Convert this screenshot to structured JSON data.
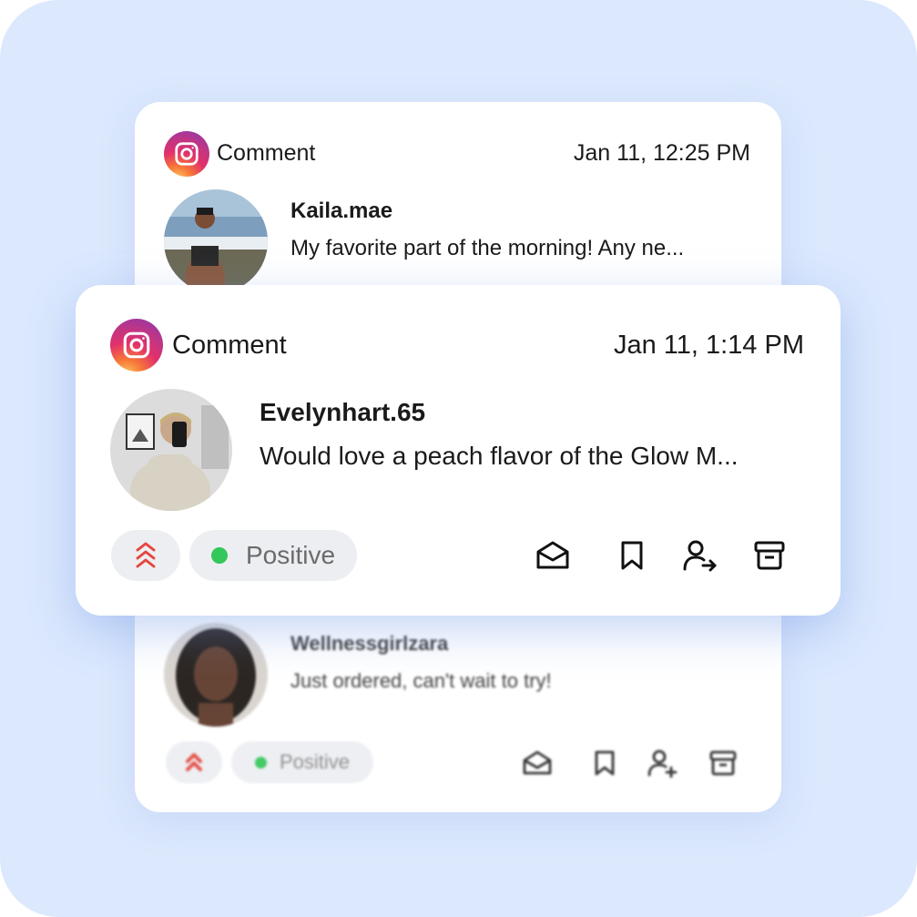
{
  "cards": {
    "top": {
      "type_label": "Comment",
      "timestamp": "Jan 11, 12:25 PM",
      "username": "Kaila.mae",
      "message": "My favorite part of the morning! Any ne..."
    },
    "front": {
      "type_label": "Comment",
      "timestamp": "Jan 11, 1:14 PM",
      "username": "Evelynhart.65",
      "message": "Would love a peach flavor of the Glow M...",
      "sentiment": "Positive"
    },
    "bottom": {
      "username": "Wellnessgirlzara",
      "message": "Just ordered, can't wait to try!",
      "sentiment": "Positive"
    }
  },
  "icons": {
    "platform": "instagram-icon",
    "priority": "chevrons-up-icon",
    "reply": "mail-open-icon",
    "save": "bookmark-icon",
    "assign": "user-arrow-icon",
    "archive": "archive-icon"
  },
  "colors": {
    "background": "#dbe8fd",
    "sentiment_positive": "#34c759",
    "priority_high": "#e5473f",
    "chip_bg": "#edeef2"
  }
}
